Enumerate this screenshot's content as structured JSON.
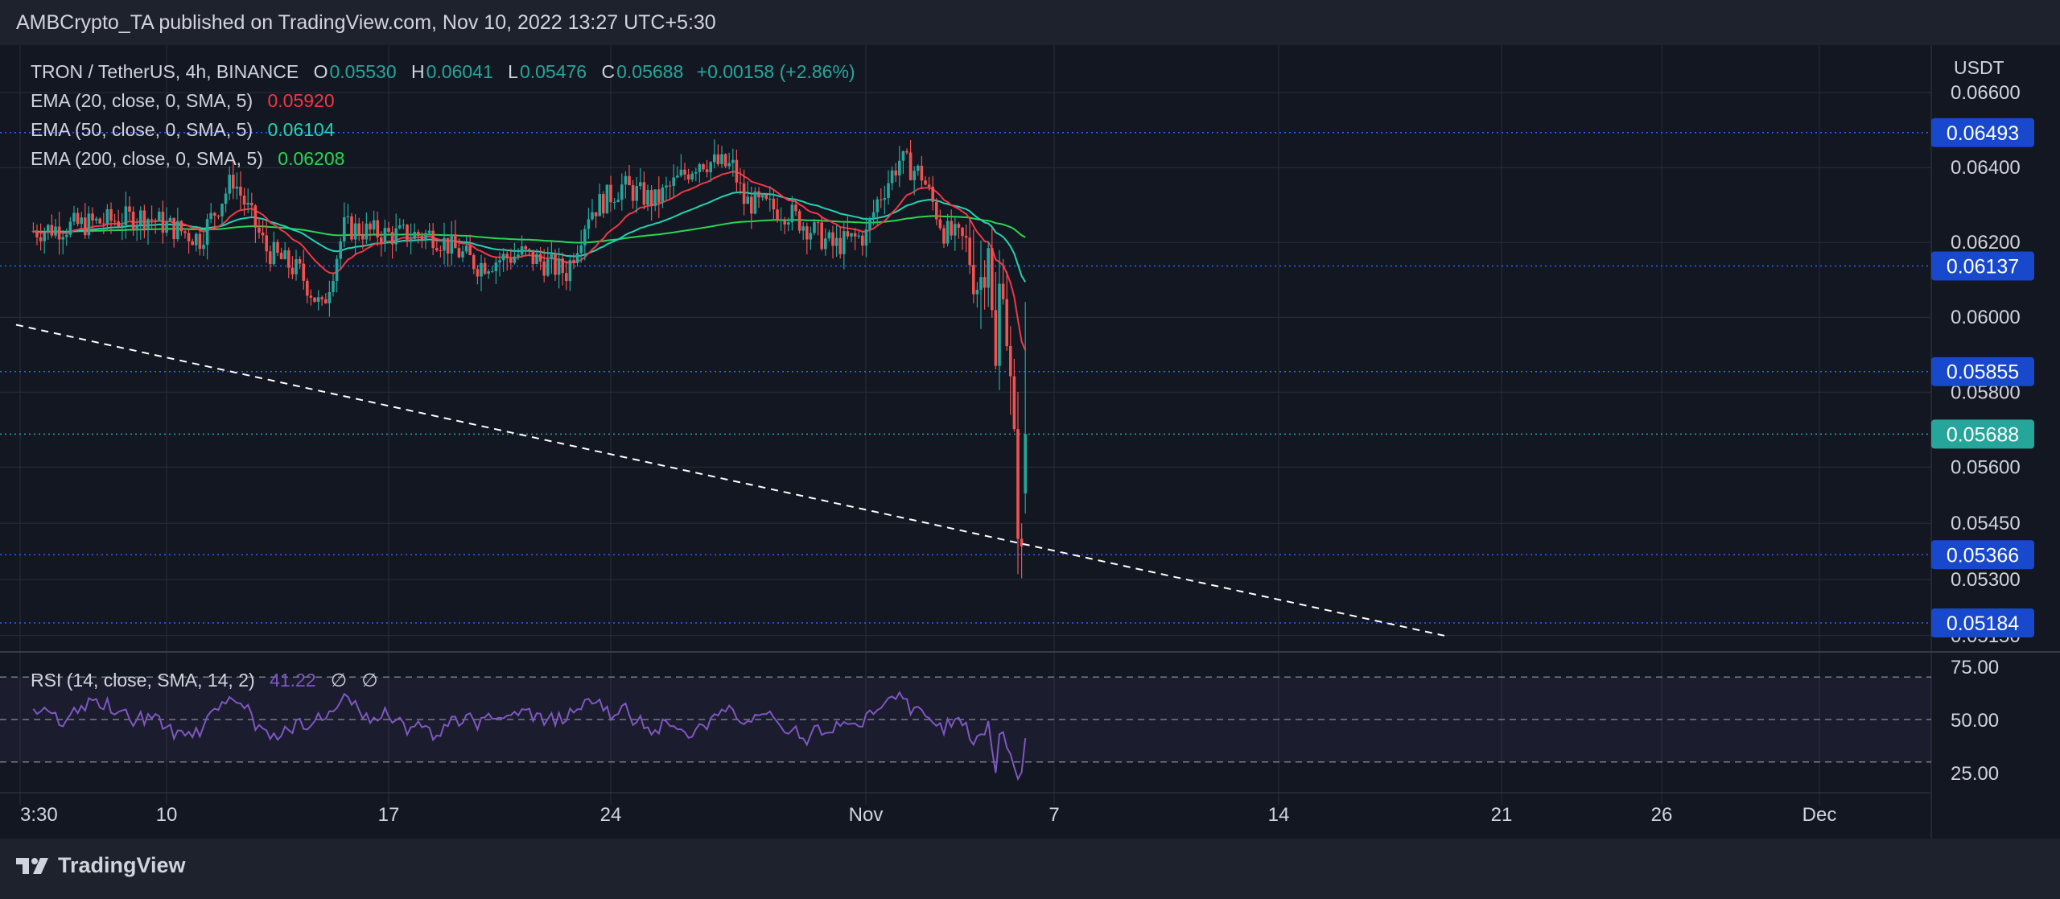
{
  "header": {
    "published": "AMBCrypto_TA published on TradingView.com, Nov 10, 2022 13:27 UTC+5:30"
  },
  "symbol": {
    "title": "TRON / TetherUS, 4h, BINANCE",
    "open_label": "O",
    "open": "0.05530",
    "high_label": "H",
    "high": "0.06041",
    "low_label": "L",
    "low": "0.05476",
    "close_label": "C",
    "close": "0.05688",
    "change": "+0.00158 (+2.86%)"
  },
  "indicators": [
    {
      "label": "EMA (20, close, 0, SMA, 5)",
      "value": "0.05920",
      "color": "#f23645"
    },
    {
      "label": "EMA (50, close, 0, SMA, 5)",
      "value": "0.06104",
      "color": "#22d3b4"
    },
    {
      "label": "EMA (200, close, 0, SMA, 5)",
      "value": "0.06208",
      "color": "#29d654"
    }
  ],
  "rsi_legend": {
    "label": "RSI (14, close, SMA, 14, 2)",
    "value": "41.22",
    "extra1": "∅",
    "extra2": "∅",
    "color": "#7e57c2"
  },
  "footer": {
    "brand": "TradingView"
  },
  "chart_data": {
    "type": "candlestick",
    "currency": "USDT",
    "price_axis_ticks": [
      "0.06600",
      "0.06400",
      "0.06200",
      "0.06000",
      "0.05800",
      "0.05600",
      "0.05450",
      "0.05300",
      "0.05150"
    ],
    "rsi_axis_ticks": [
      "75.00",
      "50.00",
      "25.00"
    ],
    "time_axis_ticks": [
      "3:30",
      "10",
      "17",
      "24",
      "Nov",
      "7",
      "14",
      "21",
      "26",
      "Dec"
    ],
    "horizontal_levels": [
      {
        "value": "0.06493",
        "color": "#1848cc"
      },
      {
        "value": "0.06137",
        "color": "#1848cc"
      },
      {
        "value": "0.05855",
        "color": "#1848cc"
      },
      {
        "value": "0.05366",
        "color": "#1848cc"
      },
      {
        "value": "0.05184",
        "color": "#1848cc"
      }
    ],
    "last_price": {
      "value": "0.05688",
      "color": "#26a69a"
    },
    "trendline": {
      "start": [
        "Oct 4",
        0.0598
      ],
      "end": [
        "Nov 19",
        0.0515
      ]
    },
    "colors": {
      "up": "#26a69a",
      "down": "#ef5350",
      "ema20": "#f23645",
      "ema50": "#22d3b4",
      "ema200": "#29d654",
      "rsi": "#7e57c2"
    }
  }
}
